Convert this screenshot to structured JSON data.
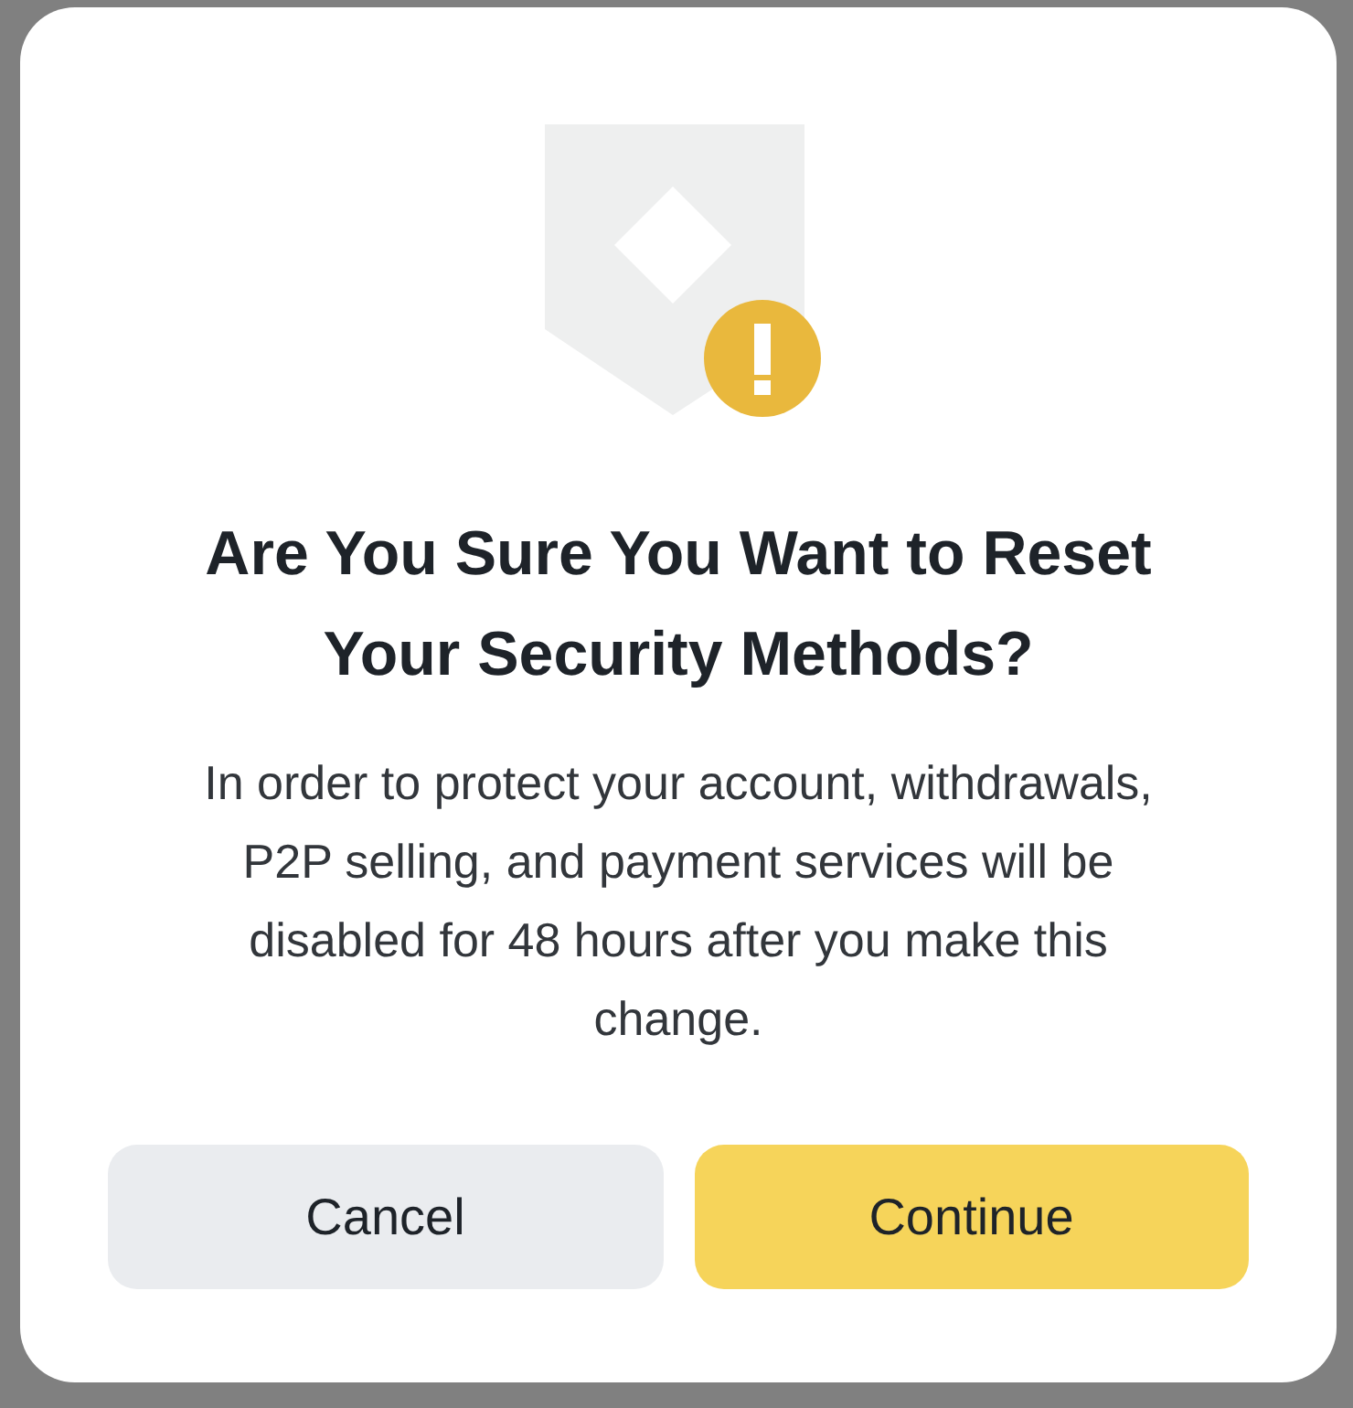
{
  "dialog": {
    "title": "Are You Sure You Want to Reset Your Security Methods?",
    "message": "In order to protect your account, withdrawals, P2P selling, and payment services will be disabled for 48 hours after you make this change.",
    "buttons": [
      {
        "label": "Cancel",
        "kind": "secondary"
      },
      {
        "label": "Continue",
        "kind": "primary"
      }
    ]
  }
}
